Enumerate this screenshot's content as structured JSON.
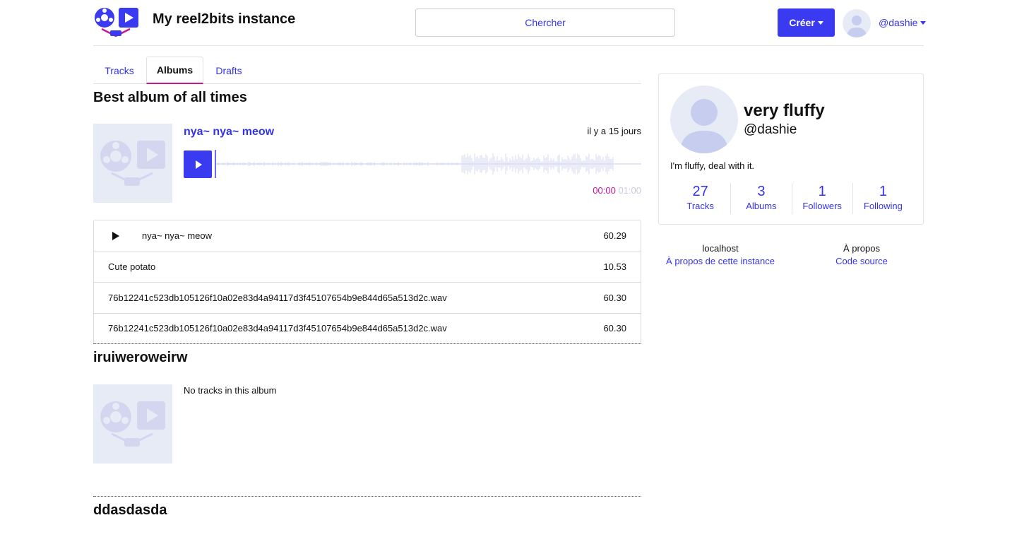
{
  "header": {
    "site_title": "My reel2bits instance",
    "search_label": "Chercher",
    "create_label": "Créer",
    "user_handle": "@dashie"
  },
  "tabs": [
    {
      "label": "Tracks",
      "active": false
    },
    {
      "label": "Albums",
      "active": true
    },
    {
      "label": "Drafts",
      "active": false
    }
  ],
  "albums": [
    {
      "title": "Best album of all times",
      "current_track": {
        "title": "nya~ nya~ meow",
        "date": "il y a 15 jours",
        "time_current": "00:00",
        "time_total": "01:00"
      },
      "tracks": [
        {
          "title": "nya~ nya~ meow",
          "value": "60.29",
          "playing": true
        },
        {
          "title": "Cute potato",
          "value": "10.53",
          "playing": false
        },
        {
          "title": "76b12241c523db105126f10a02e83d4a94117d3f45107654b9e844d65a513d2c.wav",
          "value": "60.30",
          "playing": false
        },
        {
          "title": "76b12241c523db105126f10a02e83d4a94117d3f45107654b9e844d65a513d2c.wav",
          "value": "60.30",
          "playing": false
        }
      ]
    },
    {
      "title": "iruiweroweirw",
      "empty_text": "No tracks in this album"
    },
    {
      "title": "ddasdasda"
    }
  ],
  "profile": {
    "display_name": "very fluffy",
    "handle": "@dashie",
    "bio": "I'm fluffy, deal with it.",
    "stats": [
      {
        "count": "27",
        "label": "Tracks"
      },
      {
        "count": "3",
        "label": "Albums"
      },
      {
        "count": "1",
        "label": "Followers"
      },
      {
        "count": "1",
        "label": "Following"
      }
    ]
  },
  "footer": {
    "instance_name": "localhost",
    "about_instance_link": "À propos de cette instance",
    "about_heading": "À propos",
    "source_code_link": "Code source"
  },
  "colors": {
    "accent": "#3a3af0",
    "tab_underline": "#c5169a",
    "cover_bg": "#e7ebf6"
  }
}
